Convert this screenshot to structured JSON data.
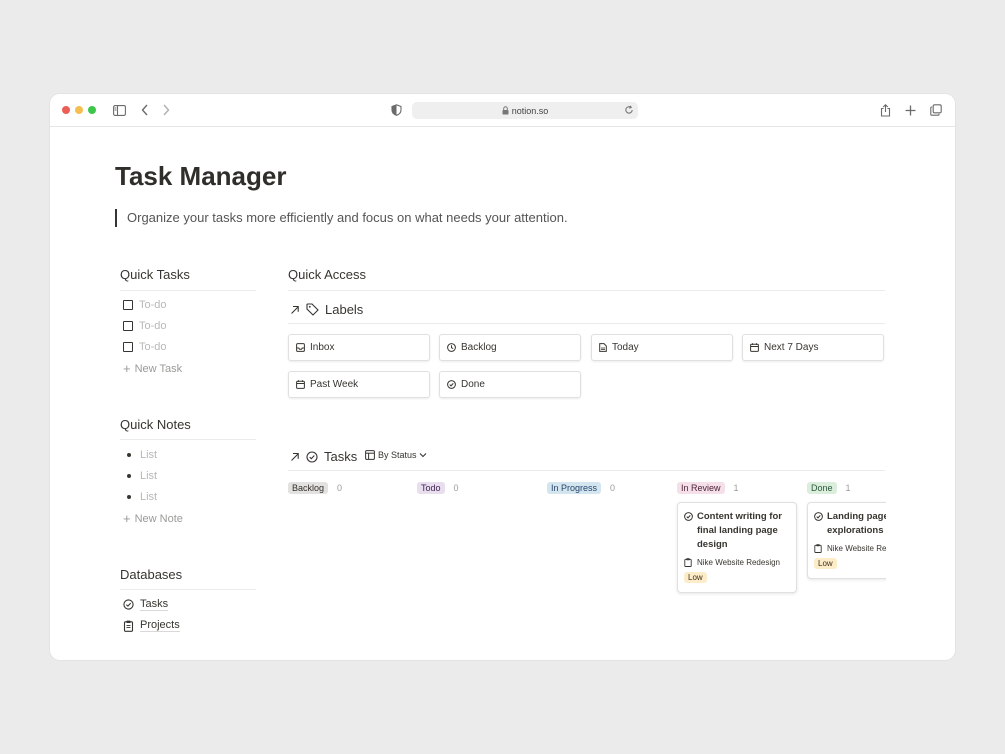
{
  "browser": {
    "url": "notion.so"
  },
  "page": {
    "title": "Task Manager",
    "description": "Organize your tasks more efficiently and focus on what needs your attention."
  },
  "quick_tasks": {
    "heading": "Quick Tasks",
    "items": [
      "To-do",
      "To-do",
      "To-do"
    ],
    "add_label": "New Task"
  },
  "quick_notes": {
    "heading": "Quick Notes",
    "items": [
      "List",
      "List",
      "List"
    ],
    "add_label": "New Note"
  },
  "databases": {
    "heading": "Databases",
    "items": [
      {
        "label": "Tasks",
        "icon": "check-circle-icon"
      },
      {
        "label": "Projects",
        "icon": "clipboard-icon"
      }
    ]
  },
  "quick_access": {
    "heading": "Quick Access",
    "labels_view": {
      "title": "Labels",
      "cards": [
        {
          "label": "Inbox",
          "icon": "inbox-icon"
        },
        {
          "label": "Backlog",
          "icon": "clock-icon"
        },
        {
          "label": "Today",
          "icon": "document-icon"
        },
        {
          "label": "Next 7 Days",
          "icon": "calendar-icon"
        },
        {
          "label": "Past Week",
          "icon": "calendar-icon"
        },
        {
          "label": "Done",
          "icon": "check-circle-icon"
        }
      ]
    },
    "tasks_view": {
      "title": "Tasks",
      "view_selector": "By Status",
      "columns": [
        {
          "label": "Backlog",
          "count": "0",
          "bg": "#e3e2e0",
          "fg": "#32302c"
        },
        {
          "label": "Todo",
          "count": "0",
          "bg": "#e8deee",
          "fg": "#412454"
        },
        {
          "label": "In Progress",
          "count": "0",
          "bg": "#d3e5ef",
          "fg": "#28456c"
        },
        {
          "label": "In Review",
          "count": "1",
          "bg": "#f5e0e9",
          "fg": "#4c2337"
        },
        {
          "label": "Done",
          "count": "1",
          "bg": "#dbeddb",
          "fg": "#2b593f"
        }
      ],
      "cards": [
        {
          "title": "Content writing for final landing page design",
          "project": "Nike Website Redesign",
          "priority": "Low"
        },
        {
          "title": "Landing page explorations",
          "project": "Nike Website Redesign",
          "priority": "Low"
        }
      ]
    }
  },
  "colors": {
    "priority_low_bg": "#fdecc8",
    "priority_low_fg": "#402c1b"
  }
}
